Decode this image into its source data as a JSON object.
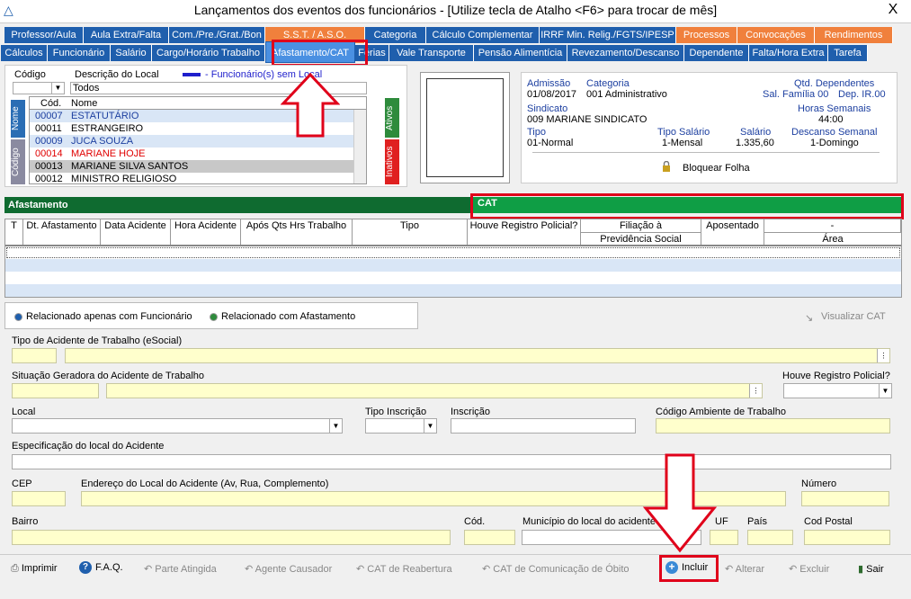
{
  "window": {
    "title": "Lançamentos dos eventos dos funcionários - [Utilize tecla de Atalho <F6> para trocar de mês]",
    "close": "X"
  },
  "tabs_row1": [
    "Professor/Aula",
    "Aula Extra/Falta",
    "Com./Pre./Grat./Bon",
    "S.S.T. / A.S.O.",
    "Categoria",
    "Cálculo Complementar",
    "IRRF Min. Relig./FGTS/IPESP",
    "Processos",
    "Convocações",
    "Rendimentos"
  ],
  "tabs_row2": [
    "Cálculos",
    "Funcionário",
    "Salário",
    "Cargo/Horário Trabalho",
    "Afastamento/CAT",
    "Férias",
    "Vale Transporte",
    "Pensão Alimentícia",
    "Revezamento/Descanso",
    "Dependente",
    "Falta/Hora Extra",
    "Tarefa"
  ],
  "filter": {
    "codigo_label": "Código",
    "descricao_label": "Descrição do Local",
    "sem_local": "- Funcionário(s) sem Local",
    "descricao_value": "Todos"
  },
  "employees": {
    "col_cod": "Cód.",
    "col_nome": "Nome",
    "side_nome": "Nome",
    "side_codigo": "Código",
    "side_ativos": "Ativos",
    "side_inativos": "Inativos",
    "rows": [
      {
        "cod": "00007",
        "nome": "ESTATUTÁRIO"
      },
      {
        "cod": "00011",
        "nome": "ESTRANGEIRO"
      },
      {
        "cod": "00009",
        "nome": "JUCA SOUZA"
      },
      {
        "cod": "00014",
        "nome": "MARIANE HOJE"
      },
      {
        "cod": "00013",
        "nome": "MARIANE SILVA SANTOS"
      },
      {
        "cod": "00012",
        "nome": "MINISTRO RELIGIOSO"
      }
    ]
  },
  "info": {
    "admissao_label": "Admissão",
    "admissao": "01/08/2017",
    "categoria_label": "Categoria",
    "categoria": "001  Administrativo",
    "qtd_label": "Qtd. Dependentes",
    "salfam": "Sal. Família 00",
    "depir": "Dep. IR.00",
    "sindicato_label": "Sindicato",
    "sindicato": "009 MARIANE SINDICATO",
    "horas_label": "Horas Semanais",
    "horas": "44:00",
    "tipo_label": "Tipo",
    "tipo": "01-Normal",
    "tiposal_label": "Tipo Salário",
    "tiposal": "1-Mensal",
    "salario_label": "Salário",
    "salario": "1.335,60",
    "descanso_label": "Descanso Semanal",
    "descanso": "1-Domingo",
    "bloquear": "Bloquear Folha"
  },
  "sections": {
    "afastamento": "Afastamento",
    "cat": "CAT"
  },
  "grid_headers": [
    "T",
    "Dt. Afastamento",
    "Data Acidente",
    "Hora Acidente",
    "Após Qts Hrs Trabalho",
    "Tipo",
    "Houve Registro Policial?",
    "Filiação à",
    "Previdência Social",
    "Aposentado",
    "-",
    "Área"
  ],
  "radios": {
    "r1": "Relacionado apenas com Funcionário",
    "r2": "Relacionado com Afastamento",
    "visualizar": "Visualizar CAT"
  },
  "form": {
    "tipo_acidente": "Tipo de Acidente de Trabalho (eSocial)",
    "situacao": "Situação Geradora do Acidente de Trabalho",
    "houve_registro": "Houve Registro Policial?",
    "local": "Local",
    "tipo_inscricao": "Tipo Inscrição",
    "inscricao": "Inscrição",
    "codigo_ambiente": "Código Ambiente de Trabalho",
    "especificacao": "Especificação do local do Acidente",
    "cep": "CEP",
    "endereco": "Endereço do Local do Acidente (Av, Rua, Complemento)",
    "numero": "Número",
    "bairro": "Bairro",
    "cod": "Cód.",
    "municipio": "Município do local do acidente",
    "uf": "UF",
    "pais": "País",
    "cod_postal": "Cod Postal"
  },
  "toolbar": {
    "imprimir": "Imprimir",
    "faq": "F.A.Q.",
    "parte": "Parte Atingida",
    "agente": "Agente Causador",
    "reabertura": "CAT de Reabertura",
    "obito": "CAT de Comunicação de Óbito",
    "incluir": "Incluir",
    "alterar": "Alterar",
    "excluir": "Excluir",
    "sair": "Sair"
  }
}
